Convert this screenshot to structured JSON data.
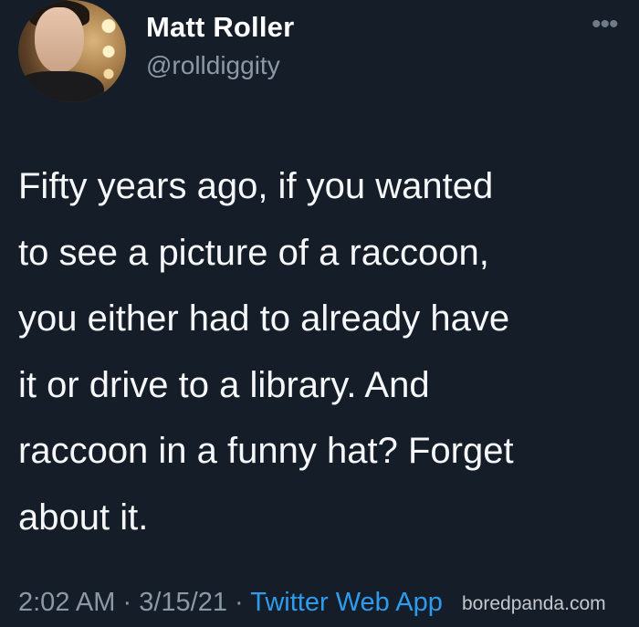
{
  "user": {
    "name": "Matt Roller",
    "handle": "@rolldiggity"
  },
  "more_icon": "more-horizontal-icon",
  "tweet": {
    "lines": [
      "Fifty years ago, if you wanted",
      "to see a picture of a raccoon,",
      "you either had to already have",
      "it or drive to a library. And",
      "raccoon in a funny hat? Forget",
      "about it."
    ]
  },
  "meta": {
    "time": "2:02 AM",
    "separator": "·",
    "date": "3/15/21",
    "source": "Twitter Web App"
  },
  "watermark": "boredpanda.com",
  "colors": {
    "background": "#151d28",
    "link": "#2d9cef",
    "secondary_text": "#8b98a5"
  }
}
